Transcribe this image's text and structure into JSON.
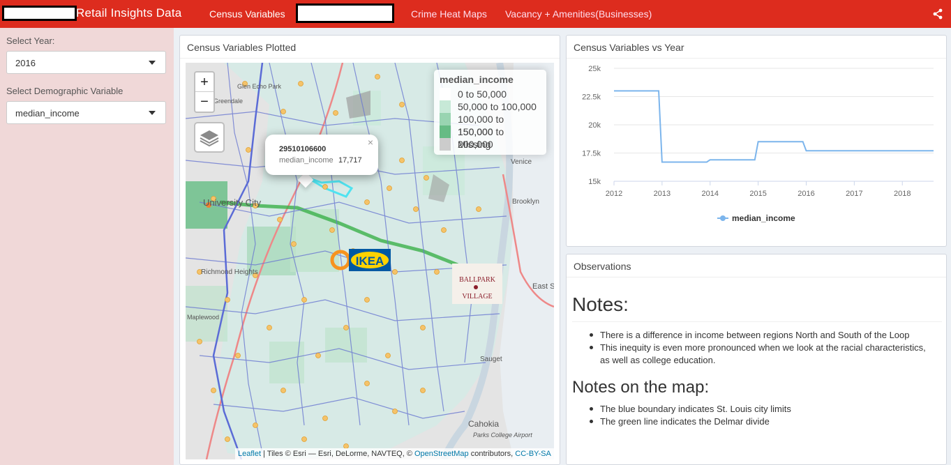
{
  "header": {
    "brand": "Retail Insights Data",
    "nav": [
      "Census Variables",
      "Crime Heat Maps",
      "Vacancy + Amenities(Businesses)"
    ],
    "share_icon": "share-icon"
  },
  "sidebar": {
    "year_label": "Select Year:",
    "year_value": "2016",
    "var_label": "Select Demographic Variable",
    "var_value": "median_income"
  },
  "map_box": {
    "title": "Census Variables Plotted",
    "zoom_in": "+",
    "zoom_out": "−",
    "legend": {
      "title": "median_income",
      "items": [
        {
          "label": "0 to 50,000",
          "color": "#ffffff"
        },
        {
          "label": "50,000 to 100,000",
          "color": "#c7e9d7"
        },
        {
          "label": "100,000 to 150,000",
          "color": "#99d4b1"
        },
        {
          "label": "150,000 to 200,000",
          "color": "#66bb84"
        },
        {
          "label": "Missing",
          "color": "#cccccc"
        }
      ]
    },
    "popup": {
      "id": "29510106600",
      "var": "median_income",
      "value": "17,717",
      "close": "×"
    },
    "map_labels": {
      "university_city": "University City",
      "richmond_heights": "Richmond Heights",
      "brooklyn": "Brooklyn",
      "east_st": "East S",
      "venice": "Venice",
      "cahokia": "Cahokia",
      "sauget": "Sauget",
      "parks_college": "Parks College Airport",
      "maplewood": "Maplewood",
      "glen_echo": "Glen Echo Park",
      "greendale": "Greendale",
      "ikea": "IKEA",
      "ballpark_line1": "BALLPARK",
      "ballpark_line2": "VILLAGE"
    },
    "attribution": {
      "leaflet": "Leaflet",
      "tiles": " | Tiles © Esri — Esri, DeLorme, NAVTEQ, © ",
      "osm": "OpenStreetMap",
      "contrib": " contributors, ",
      "license": "CC-BY-SA"
    }
  },
  "chart_box": {
    "title": "Census Variables vs Year"
  },
  "chart_data": {
    "type": "line",
    "title": "",
    "xlabel": "",
    "ylabel": "",
    "xlim": [
      2012,
      2018.65
    ],
    "ylim": [
      15000,
      25000
    ],
    "yticks": [
      15000,
      17500,
      20000,
      22500,
      25000
    ],
    "ytick_labels": [
      "15k",
      "17.5k",
      "20k",
      "22.5k",
      "25k"
    ],
    "xticks": [
      2012,
      2013,
      2014,
      2015,
      2016,
      2017,
      2018
    ],
    "xtick_labels": [
      "2012",
      "2013",
      "2014",
      "2015",
      "2016",
      "2017",
      "2018"
    ],
    "grid": true,
    "legend_position": "bottom",
    "series": [
      {
        "name": "median_income",
        "color": "#7cb5ec",
        "x": [
          2012,
          2012.93,
          2013.0,
          2013.93,
          2014.0,
          2014.93,
          2015.0,
          2015.93,
          2016.0,
          2018.65
        ],
        "y": [
          23000,
          23000,
          16700,
          16700,
          16900,
          16900,
          18500,
          18500,
          17700,
          17700
        ]
      }
    ]
  },
  "observations": {
    "title": "Observations",
    "notes_heading": "Notes:",
    "notes": [
      "There is a difference in income between regions North and South of the Loop",
      "This inequity is even more pronounced when we look at the racial characteristics, as well as college education."
    ],
    "map_heading": "Notes on the map:",
    "map_notes": [
      "The blue boundary indicates St. Louis city limits",
      "The green line indicates the Delmar divide"
    ]
  }
}
